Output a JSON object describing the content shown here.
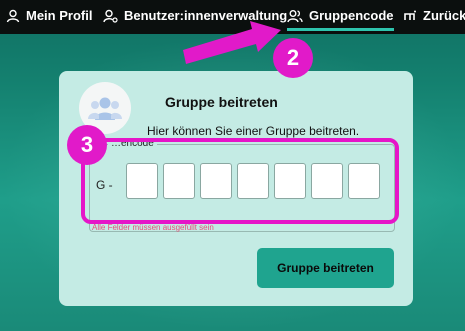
{
  "nav": {
    "items": [
      {
        "label": "Mein Profil",
        "icon": "user-icon"
      },
      {
        "label": "Benutzer:innenverwaltung",
        "icon": "user-settings-icon"
      },
      {
        "label": "Gruppencode",
        "icon": "users-icon",
        "active": true
      },
      {
        "label": "Zurück",
        "icon": "back-icon"
      }
    ]
  },
  "card": {
    "title": "Gruppe beitreten",
    "subtitle": "Hier können Sie einer Gruppe beitreten.",
    "legend": "…encode",
    "prefix": "G -",
    "code_values": [
      "",
      "",
      "",
      "",
      "",
      "",
      ""
    ],
    "error": "Alle Felder müssen ausgefüllt sein",
    "join_label": "Gruppe beitreten"
  },
  "annotations": {
    "marker_2": "2",
    "marker_3": "3"
  },
  "colors": {
    "accent": "#1fa48f",
    "highlight": "#e515c8",
    "error": "#e4527a"
  }
}
